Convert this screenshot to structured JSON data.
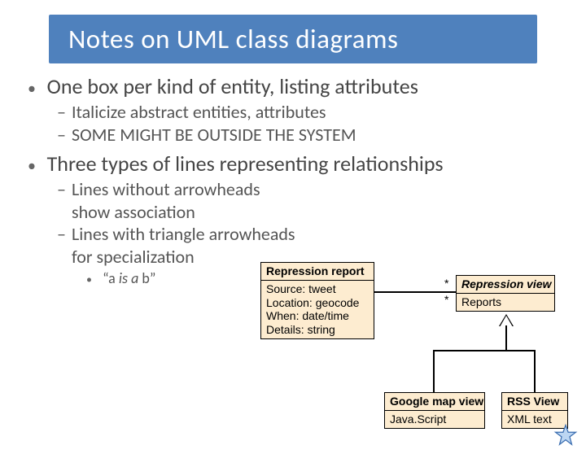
{
  "title": "Notes on UML class diagrams",
  "bullets": {
    "b1": "One box per kind of entity, listing attributes",
    "b1a": "Italicize abstract entities, attributes",
    "b1b": "SOME MIGHT BE OUTSIDE THE SYSTEM",
    "b2": "Three types of lines representing relationships",
    "b2a": "Lines without arrowheads show association",
    "b2b": "Lines with triangle arrowheads for specialization",
    "b2b1_prefix": "“a ",
    "b2b1_mid": "is a",
    "b2b1_suffix": " b”"
  },
  "uml": {
    "repression_report": {
      "name": "Repression report",
      "attrs": [
        "Source: tweet",
        "Location: geocode",
        "When: date/time",
        "Details: string"
      ]
    },
    "repression_view": {
      "name": "Repression view",
      "attrs": [
        "Reports"
      ]
    },
    "gmap": {
      "name": "Google map view",
      "attrs": [
        "Java.Script"
      ]
    },
    "rss": {
      "name": "RSS View",
      "attrs": [
        "XML text"
      ]
    },
    "mult_left": "*",
    "mult_right": "*"
  }
}
